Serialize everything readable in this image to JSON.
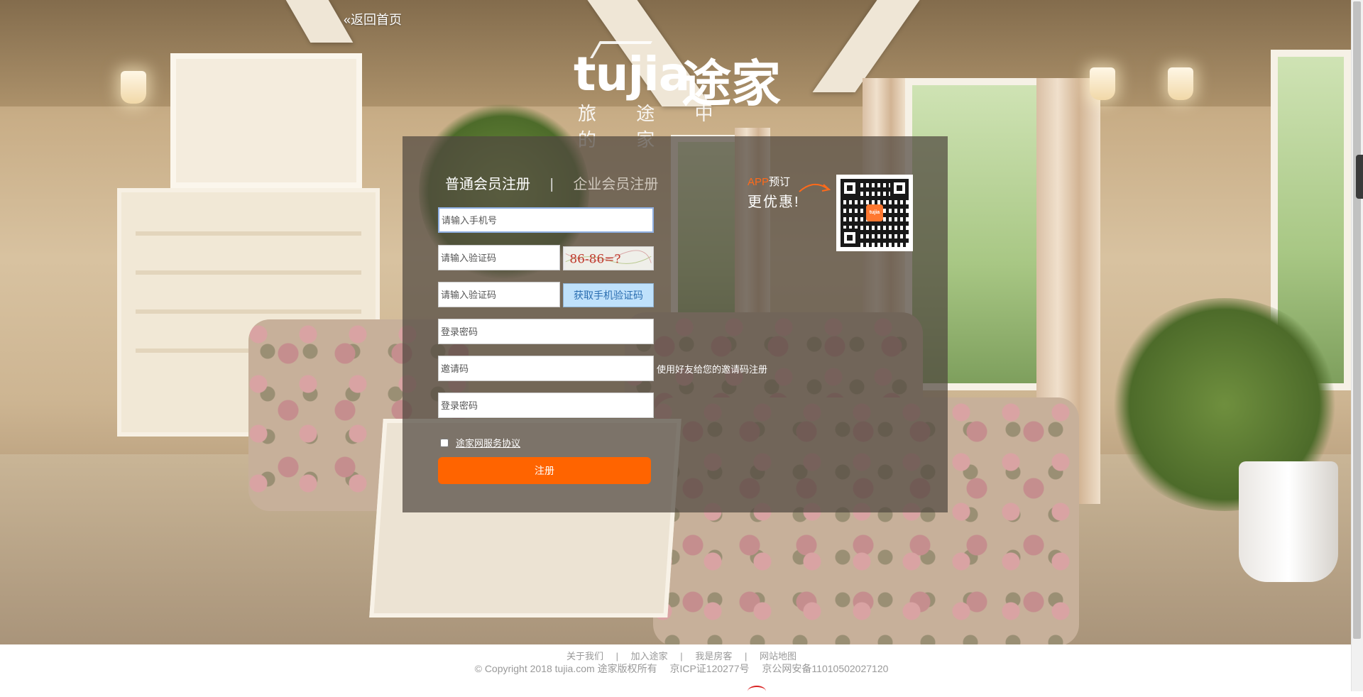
{
  "header": {
    "back_link": "«返回首页"
  },
  "logo": {
    "latin": "tujia",
    "chinese": "途家",
    "slogan": "旅 途 中 的 家"
  },
  "tabs": {
    "active": "普通会员注册",
    "separator": "|",
    "other": "企业会员注册"
  },
  "app_promo": {
    "app": "APP",
    "book": "预订",
    "better": "更优惠!",
    "qr_logo": "tujia"
  },
  "form": {
    "phone_placeholder": "请输入手机号",
    "captcha_placeholder": "请输入验证码",
    "captcha_text": "86-86=?",
    "sms_placeholder": "请输入验证码",
    "sms_button": "获取手机验证码",
    "password_placeholder": "登录密码",
    "invite_placeholder": "邀请码",
    "invite_hint": "使用好友给您的邀请码注册",
    "confirm_placeholder": "登录密码",
    "agreement": "途家网服务协议",
    "submit": "注册"
  },
  "footer": {
    "links": [
      "关于我们",
      "加入途家",
      "我是房客",
      "网站地图"
    ],
    "separator": "|",
    "copyright": "© Copyright 2018 tujia.com 途家版权所有",
    "icp": "京ICP证120277号",
    "police": "京公网安备11010502027120"
  },
  "colors": {
    "accent": "#ff6400",
    "sms_button_bg": "#bfe1fb",
    "panel_bg": "rgba(80,72,64,0.72)"
  },
  "icons": [
    "arrow-icon",
    "qr-code-icon",
    "checkbox-icon"
  ]
}
